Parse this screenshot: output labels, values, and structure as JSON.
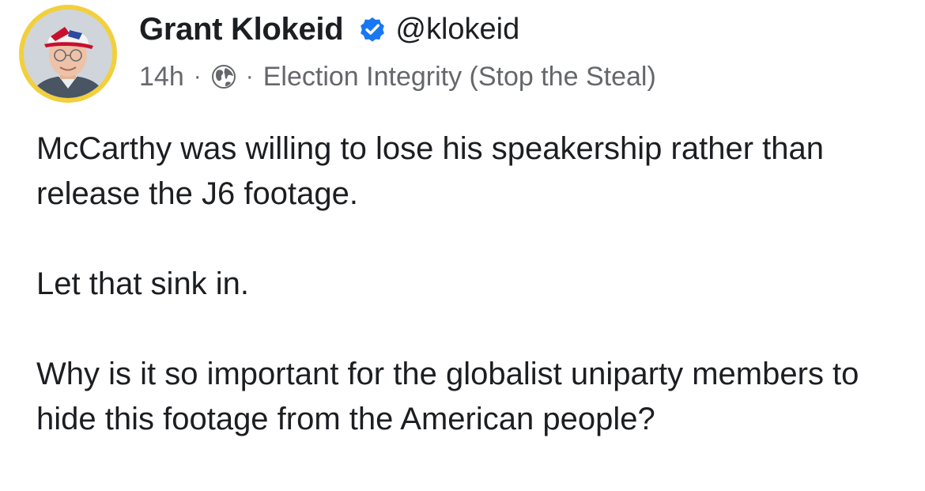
{
  "post": {
    "author": {
      "name": "Grant Klokeid",
      "handle": "@klokeid",
      "verified_icon": "verified-badge-icon",
      "avatar": "profile-photo"
    },
    "meta": {
      "time": "14h",
      "separator": "·",
      "audience_icon": "globe-icon",
      "group": "Election Integrity (Stop the Steal)"
    },
    "body": {
      "paragraphs": [
        "McCarthy was willing to lose his speakership rather than release the J6 footage.",
        "Let that sink in.",
        "Why is it so important for the globalist uniparty members to hide this footage from the American people?"
      ]
    },
    "colors": {
      "text": "#1c1e21",
      "secondary_text": "#65676b",
      "verified_blue": "#1877f2",
      "avatar_ring": "#f2cf3d"
    }
  }
}
